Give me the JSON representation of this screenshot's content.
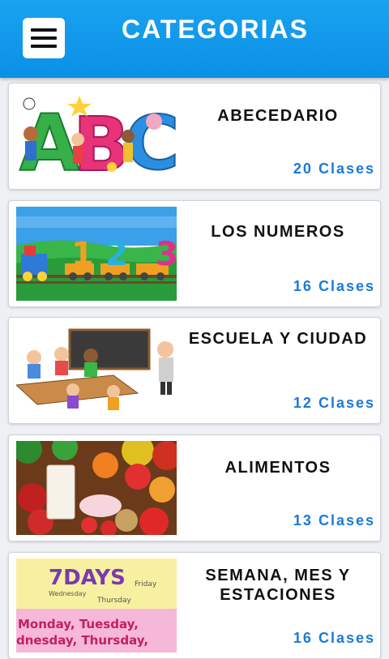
{
  "header": {
    "title": "CATEGORIAS",
    "menu_icon": "hamburger-menu-icon"
  },
  "categories": [
    {
      "title": "ABECEDARIO",
      "count": "20 Clases",
      "image": "abc-letters-kids-image"
    },
    {
      "title": "LOS NUMEROS",
      "count": "16 Clases",
      "image": "number-train-image"
    },
    {
      "title": "ESCUELA Y CIUDAD",
      "count": "12 Clases",
      "image": "classroom-image"
    },
    {
      "title": "ALIMENTOS",
      "count": "13 Clases",
      "image": "food-image"
    },
    {
      "title": "SEMANA, MES Y ESTACIONES",
      "count": "16 Clases",
      "image": "seven-days-image",
      "image_text": {
        "heading": "7DAYS",
        "small": [
          "Wednesday",
          "Thursday",
          "Friday"
        ],
        "days": [
          "Monday, Tuesday,",
          "dnesday, Thursday,"
        ]
      }
    }
  ],
  "colors": {
    "appbar": "#0a8fe6",
    "count_text": "#1a7ad9"
  }
}
